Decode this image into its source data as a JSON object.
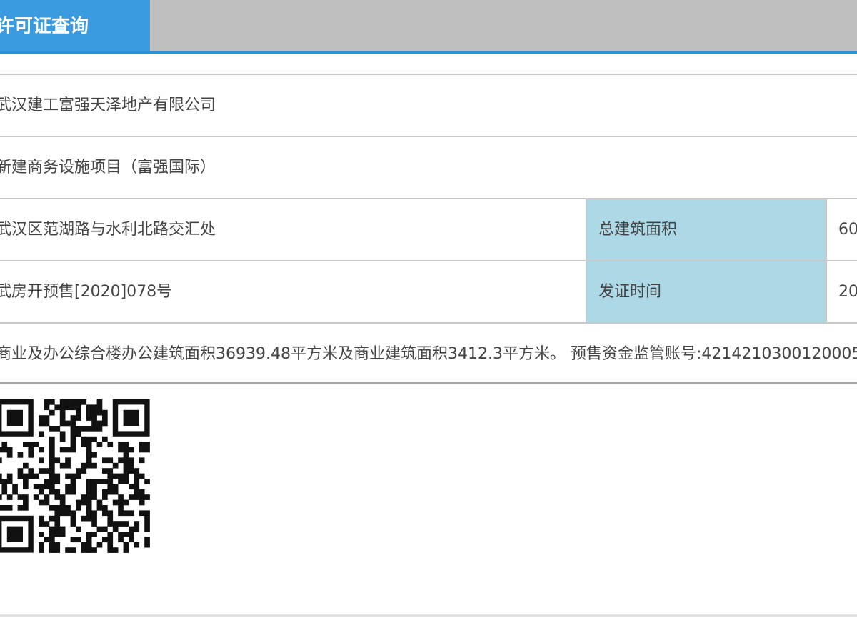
{
  "header": {
    "active_tab_label": "许可证查询"
  },
  "info": {
    "developer": "武汉建工富强天泽地产有限公司",
    "project_name": "新建商务设施项目（富强国际）",
    "address": "武汉区范湖路与水利北路交汇处",
    "total_area_label": "总建筑面积",
    "total_area_value": "60",
    "permit_number": "武房开预售[2020]078号",
    "issue_date_label": "发证时间",
    "issue_date_value": "20",
    "scope_note": "商业及办公综合楼办公建筑面积36939.48平方米及商业建筑面积3412.3平方米。 预售资金监管账号:4214210300120005"
  },
  "qr": {
    "icon": "qr-code-icon"
  },
  "colors": {
    "tab_active_bg": "#3a9be0",
    "tab_bar_bg": "#bfbfbf",
    "label_cell_bg": "#add8e6"
  }
}
